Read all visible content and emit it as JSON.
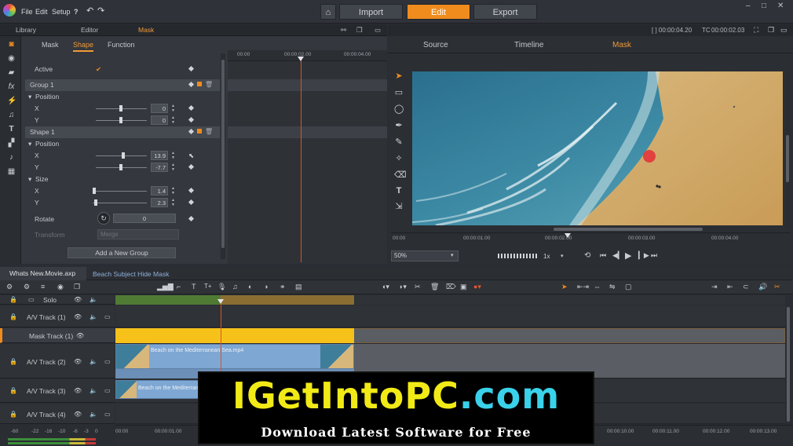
{
  "menu": {
    "file": "File",
    "edit": "Edit",
    "setup": "Setup",
    "help": "?"
  },
  "modes": {
    "import": "Import",
    "edit": "Edit",
    "export": "Export",
    "active": "Edit"
  },
  "window": {
    "minimize": "–",
    "maximize": "□",
    "close": "✕"
  },
  "left_tabs": {
    "library": "Library",
    "editor": "Editor",
    "mask": "Mask"
  },
  "fx_tabs": {
    "mask": "Mask",
    "shape": "Shape",
    "function": "Function",
    "active": "Shape"
  },
  "params": {
    "active_label": "Active",
    "group1": "Group 1",
    "position": "Position",
    "x": "X",
    "y": "Y",
    "group_x": "0",
    "group_y": "0",
    "shape1": "Shape 1",
    "shape_x": "13.9",
    "shape_y": "-7.7",
    "size": "Size",
    "size_x": "1.4",
    "size_y": "2.3",
    "rotate": "Rotate",
    "rotate_val": "0",
    "transform": "Transform",
    "transform_val": "Merge",
    "add_group": "Add a New Group"
  },
  "kf_ruler": {
    "t0": "00:00",
    "t1": "00:00:02.00",
    "t2": "00:00:04.00"
  },
  "preview": {
    "timecode_a": "[ ] 00:00:04.20",
    "tc_label": "TC",
    "timecode_b": "00:00:02.03",
    "tabs": {
      "source": "Source",
      "timeline": "Timeline",
      "mask": "Mask",
      "active": "Mask"
    },
    "ruler": [
      "00:00",
      "00:00:01.00",
      "00:00:02.00",
      "00:00:03.00",
      "00:00:04.00"
    ],
    "zoom": "50%",
    "speed": "1x"
  },
  "timeline": {
    "project_tab": "Whats New.Movie.axp",
    "sub_tab": "Beach Subject Hide Mask",
    "tracks": [
      {
        "name": "Solo"
      },
      {
        "name": "A/V Track (1)"
      },
      {
        "name": "Mask Track (1)"
      },
      {
        "name": "A/V Track (2)"
      },
      {
        "name": "A/V Track (3)"
      },
      {
        "name": "A/V Track (4)"
      }
    ],
    "clip1": "Beach on the Mediterranean Sea.mp4",
    "clip2": "Beach on the Mediterran",
    "ruler": [
      "00:00",
      "00:00:01.00",
      "00:00:10.00",
      "00:00:11.00",
      "00:00:12.00",
      "00:00:13.00"
    ],
    "meter": [
      "-60",
      "-22",
      "-16",
      "-10",
      "-6",
      "-3",
      "0"
    ]
  },
  "watermark": {
    "big_a": "IGetIntoPC",
    "big_b": ".com",
    "small": "Download Latest Software for Free"
  },
  "colors": {
    "accent": "#f08c1e",
    "mask_clip": "#f6c21a",
    "video_clip": "#7ea7d3"
  }
}
